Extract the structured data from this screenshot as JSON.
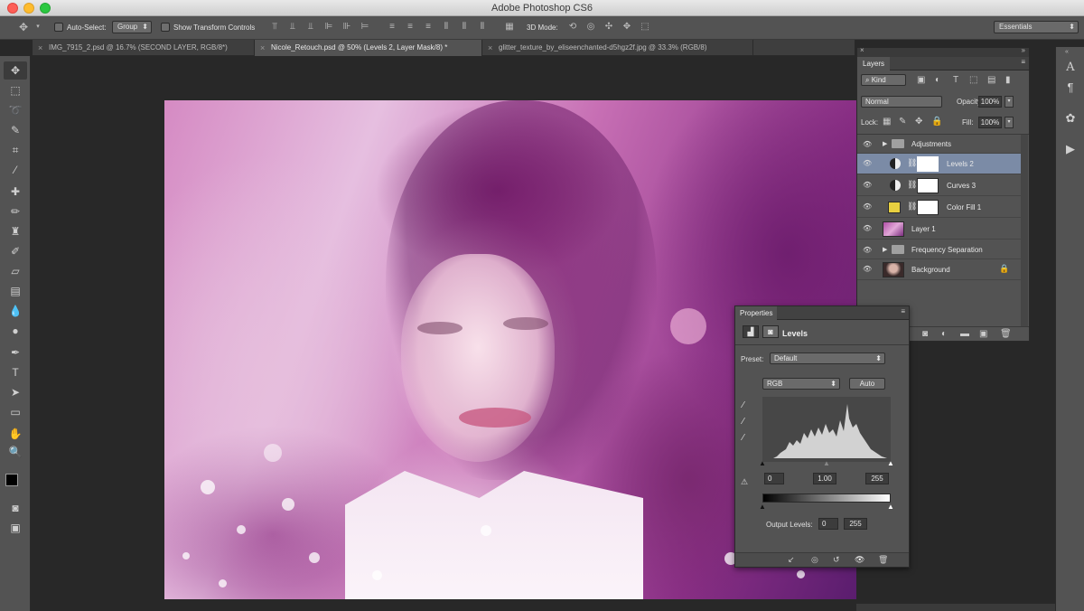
{
  "app": {
    "title": "Adobe Photoshop CS6"
  },
  "options_bar": {
    "auto_select_label": "Auto-Select:",
    "auto_select_value": "Group",
    "show_transform_label": "Show Transform Controls",
    "mode_3d_label": "3D Mode:",
    "workspace": "Essentials"
  },
  "tabs": [
    {
      "label": "IMG_7915_2.psd @ 16.7% (SECOND LAYER, RGB/8*)",
      "active": false
    },
    {
      "label": "Nicole_Retouch.psd @ 50% (Levels 2, Layer Mask/8) *",
      "active": true
    },
    {
      "label": "glitter_texture_by_eliseenchanted-d5hgz2f.jpg @ 33.3% (RGB/8)",
      "active": false
    }
  ],
  "layers_panel": {
    "tab_label": "Layers",
    "kind_label": "Kind",
    "blend_mode": "Normal",
    "opacity_label": "Opacity:",
    "opacity_value": "100%",
    "lock_label": "Lock:",
    "fill_label": "Fill:",
    "fill_value": "100%",
    "layers": [
      {
        "name": "Adjustments",
        "type": "group"
      },
      {
        "name": "Levels 2",
        "type": "adjustment",
        "selected": true
      },
      {
        "name": "Curves 3",
        "type": "adjustment"
      },
      {
        "name": "Color Fill 1",
        "type": "fill",
        "color": "#e8d040"
      },
      {
        "name": "Layer 1",
        "type": "pixel"
      },
      {
        "name": "Frequency Separation",
        "type": "group"
      },
      {
        "name": "Background",
        "type": "background",
        "locked": true
      }
    ]
  },
  "properties_panel": {
    "tab_label": "Properties",
    "adjustment_name": "Levels",
    "preset_label": "Preset:",
    "preset_value": "Default",
    "channel": "RGB",
    "auto_label": "Auto",
    "input_black": "0",
    "input_gamma": "1.00",
    "input_white": "255",
    "output_label": "Output Levels:",
    "output_black": "0",
    "output_white": "255"
  },
  "colors": {
    "panel_bg": "#535353",
    "dark_bg": "#282828",
    "selected_layer": "#7b8ba6",
    "foreground": "#000000",
    "background": "#ffffff"
  }
}
